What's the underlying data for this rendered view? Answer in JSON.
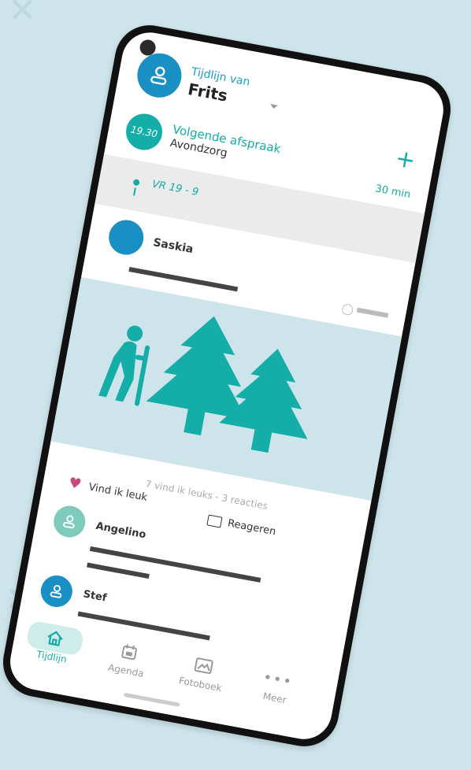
{
  "header": {
    "subtitle": "Tijdlijn van",
    "name": "Frits",
    "add_label": "+"
  },
  "appointment": {
    "time": "19.30",
    "title": "Volgende afspraak",
    "subtitle": "Avondzorg",
    "duration": "30 min"
  },
  "date": {
    "label": "VR 19 - 9"
  },
  "post": {
    "author": "Saskia",
    "stats": "7 vind ik leuks - 3 reacties",
    "like_label": "Vind ik leuk",
    "comment_label": "Reageren"
  },
  "comments": [
    {
      "author": "Angelino",
      "avatar_color": "#7ecabc"
    },
    {
      "author": "Stef",
      "avatar_color": "#1a8fc3"
    }
  ],
  "nav": {
    "items": [
      {
        "label": "Tijdlijn",
        "icon": "home-icon",
        "active": true
      },
      {
        "label": "Agenda",
        "icon": "calendar-icon",
        "active": false
      },
      {
        "label": "Fotoboek",
        "icon": "image-icon",
        "active": false
      },
      {
        "label": "Meer",
        "icon": "more-icon",
        "active": false
      }
    ]
  },
  "colors": {
    "accent": "#15aba5",
    "primary_blue": "#1a8fc3",
    "like": "#c8487b",
    "background": "#cce4ea"
  }
}
